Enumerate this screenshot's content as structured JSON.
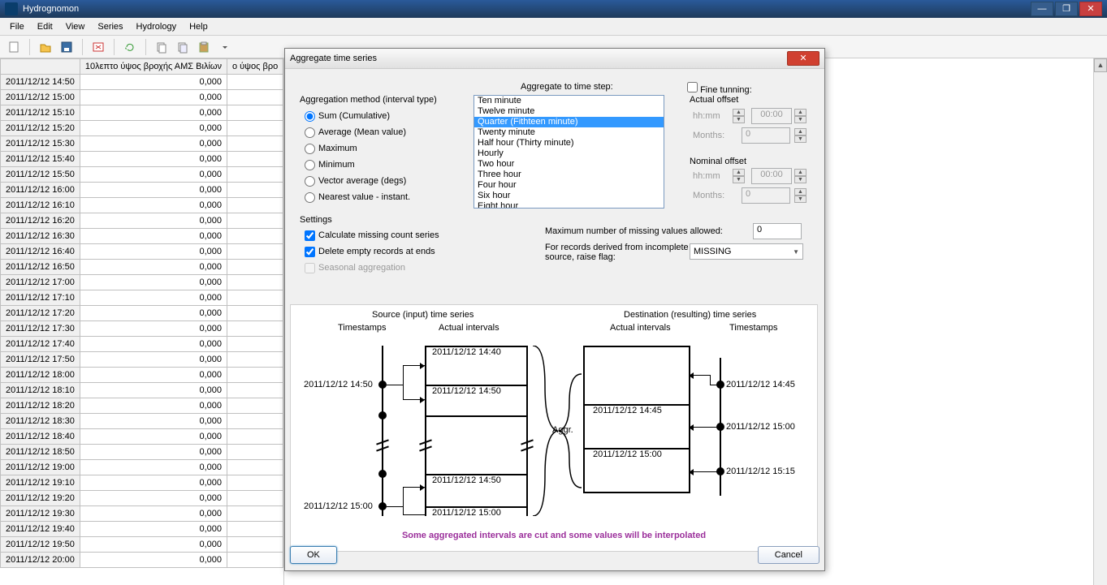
{
  "window": {
    "title": "Hydrognomon"
  },
  "menu": [
    "File",
    "Edit",
    "View",
    "Series",
    "Hydrology",
    "Help"
  ],
  "grid": {
    "col1_header": "10λεπτο ύψος βροχής ΑΜΣ Βιλίων",
    "col2_header": "ο ύψος βρο",
    "rows": [
      "2011/12/12 14:50",
      "2011/12/12 15:00",
      "2011/12/12 15:10",
      "2011/12/12 15:20",
      "2011/12/12 15:30",
      "2011/12/12 15:40",
      "2011/12/12 15:50",
      "2011/12/12 16:00",
      "2011/12/12 16:10",
      "2011/12/12 16:20",
      "2011/12/12 16:30",
      "2011/12/12 16:40",
      "2011/12/12 16:50",
      "2011/12/12 17:00",
      "2011/12/12 17:10",
      "2011/12/12 17:20",
      "2011/12/12 17:30",
      "2011/12/12 17:40",
      "2011/12/12 17:50",
      "2011/12/12 18:00",
      "2011/12/12 18:10",
      "2011/12/12 18:20",
      "2011/12/12 18:30",
      "2011/12/12 18:40",
      "2011/12/12 18:50",
      "2011/12/12 19:00",
      "2011/12/12 19:10",
      "2011/12/12 19:20",
      "2011/12/12 19:30",
      "2011/12/12 19:40",
      "2011/12/12 19:50",
      "2011/12/12 20:00"
    ],
    "value": "0,000"
  },
  "dialog": {
    "title": "Aggregate time series",
    "agg_method_label": "Aggregation method (interval type)",
    "radios": {
      "sum": "Sum (Cumulative)",
      "avg": "Average (Mean value)",
      "max": "Maximum",
      "min": "Minimum",
      "vec": "Vector average (degs)",
      "near": "Nearest value - instant."
    },
    "timestep_label": "Aggregate to time step:",
    "timesteps": [
      "Ten minute",
      "Twelve minute",
      "Quarter (Fithteen minute)",
      "Twenty minute",
      "Half hour (Thirty minute)",
      "Hourly",
      "Two hour",
      "Three hour",
      "Four hour",
      "Six hour",
      "Eight hour"
    ],
    "timestep_selected": 2,
    "fine_tuning": "Fine tunning:",
    "actual_offset": "Actual offset",
    "nominal_offset": "Nominal offset",
    "hhmm": "hh:mm",
    "months": "Months:",
    "offset_time": "00:00",
    "offset_months": "0",
    "settings_label": "Settings",
    "chk_missing": "Calculate missing count series",
    "chk_delete": "Delete empty records at ends",
    "chk_seasonal": "Seasonal aggregation",
    "max_missing_label": "Maximum number of missing values allowed:",
    "max_missing_value": "0",
    "incomplete_label1": "For records derived from incomplete",
    "incomplete_label2": "source, raise flag:",
    "flag_selected": "MISSING",
    "diagram": {
      "src_title": "Source (input) time series",
      "dst_title": "Destination (resulting) time series",
      "timestamps": "Timestamps",
      "actual_intervals": "Actual intervals",
      "aggr": "Aggr.",
      "src_ts": [
        "2011/12/12 14:50",
        "2011/12/12 15:00"
      ],
      "src_int": [
        "2011/12/12 14:40",
        "2011/12/12 14:50",
        "2011/12/12 14:50",
        "2011/12/12 15:00"
      ],
      "dst_int": [
        "2011/12/12 14:45",
        "2011/12/12 15:00"
      ],
      "dst_ts": [
        "2011/12/12 14:45",
        "2011/12/12 15:00",
        "2011/12/12 15:15"
      ],
      "warning": "Some aggregated intervals are cut and some values will be interpolated"
    },
    "ok": "OK",
    "cancel": "Cancel"
  }
}
